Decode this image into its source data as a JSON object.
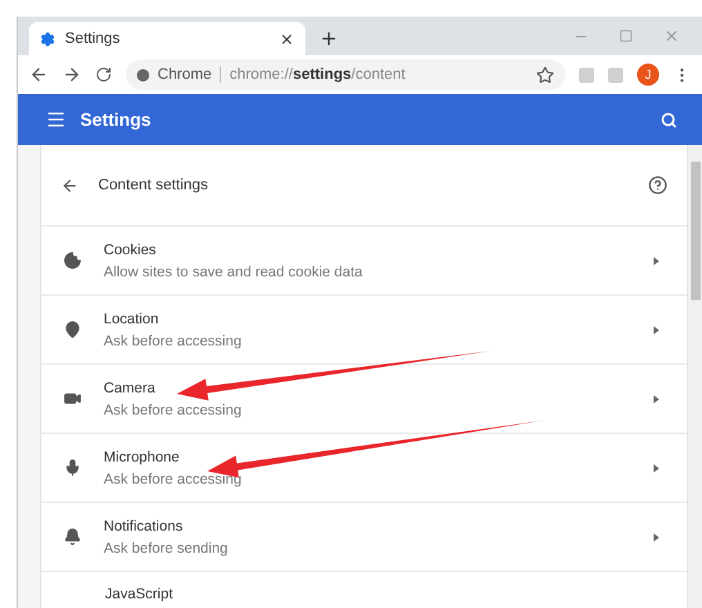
{
  "tab": {
    "title": "Settings",
    "selected": true
  },
  "address": {
    "site": "Chrome",
    "url": "chrome://**settings**/content"
  },
  "profile": {
    "initial": "J"
  },
  "header": {
    "title": "Settings"
  },
  "subpage": {
    "title": "Content settings"
  },
  "rows": [
    {
      "title": "Cookies",
      "subtitle": "Allow sites to save and read cookie data"
    },
    {
      "title": "Location",
      "subtitle": "Ask before accessing"
    },
    {
      "title": "Camera",
      "subtitle": "Ask before accessing"
    },
    {
      "title": "Microphone",
      "subtitle": "Ask before accessing"
    },
    {
      "title": "Notifications",
      "subtitle": "Ask before sending"
    },
    {
      "title": "JavaScript"
    }
  ]
}
